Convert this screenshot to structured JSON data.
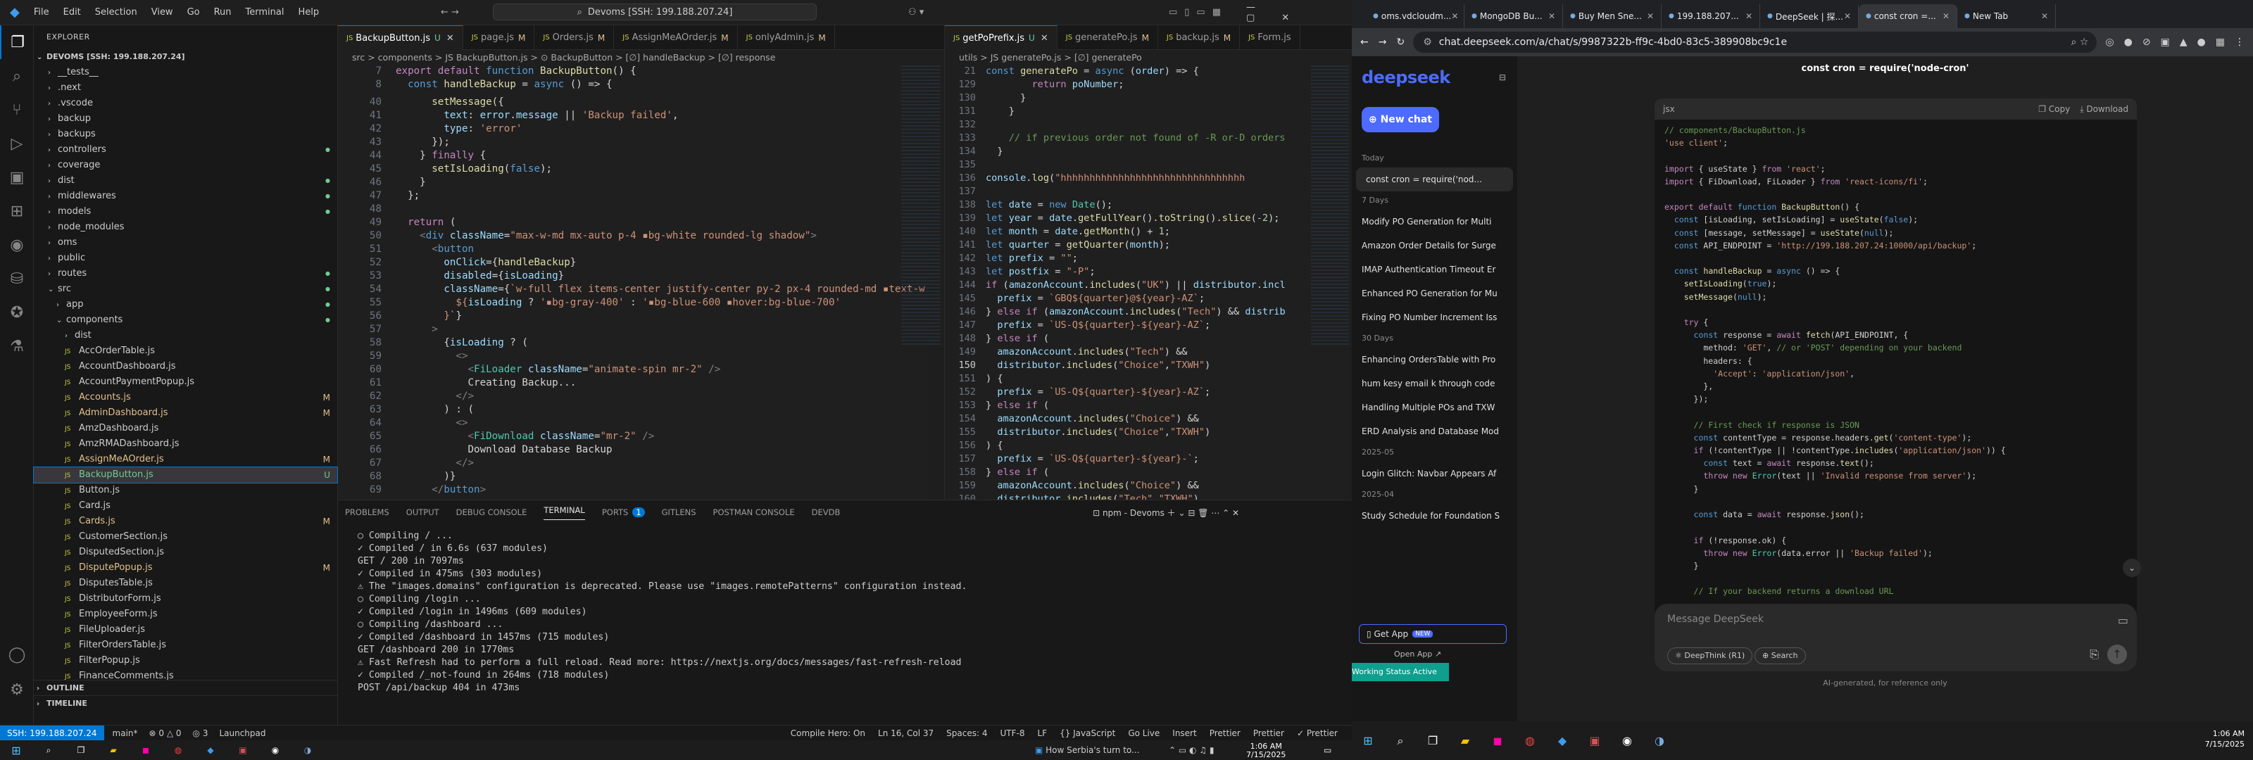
{
  "vscode": {
    "menu": [
      "File",
      "Edit",
      "Selection",
      "View",
      "Go",
      "Run",
      "Terminal",
      "Help"
    ],
    "command_center": "Devoms [SSH: 199.188.207.24]",
    "explorer_title": "EXPLORER",
    "root": "DEVOMS [SSH: 199.188.207.24]",
    "tree": [
      {
        "l": "__tests__",
        "d": 1,
        "c": true
      },
      {
        "l": ".next",
        "d": 1,
        "c": true
      },
      {
        "l": ".vscode",
        "d": 1,
        "c": true
      },
      {
        "l": "backup",
        "d": 1,
        "c": true
      },
      {
        "l": "backups",
        "d": 1,
        "c": true
      },
      {
        "l": "controllers",
        "d": 1,
        "c": true,
        "dot": true
      },
      {
        "l": "coverage",
        "d": 1,
        "c": true
      },
      {
        "l": "dist",
        "d": 1,
        "c": true,
        "dot": true
      },
      {
        "l": "middlewares",
        "d": 1,
        "c": true,
        "dot": true
      },
      {
        "l": "models",
        "d": 1,
        "c": true,
        "dot": true
      },
      {
        "l": "node_modules",
        "d": 1,
        "c": true
      },
      {
        "l": "oms",
        "d": 1,
        "c": true
      },
      {
        "l": "public",
        "d": 1,
        "c": true
      },
      {
        "l": "routes",
        "d": 1,
        "c": true,
        "dot": true
      },
      {
        "l": "src",
        "d": 1,
        "o": true,
        "dot": true
      },
      {
        "l": "app",
        "d": 2,
        "c": true,
        "dot": true
      },
      {
        "l": "components",
        "d": 2,
        "o": true,
        "dot": true
      },
      {
        "l": "dist",
        "d": 3,
        "c": true
      },
      {
        "l": "AccOrderTable.js",
        "d": 3
      },
      {
        "l": "AccountDashboard.js",
        "d": 3
      },
      {
        "l": "AccountPaymentPopup.js",
        "d": 3
      },
      {
        "l": "Accounts.js",
        "d": 3,
        "b": "M"
      },
      {
        "l": "AdminDashboard.js",
        "d": 3,
        "b": "M"
      },
      {
        "l": "AmzDashboard.js",
        "d": 3
      },
      {
        "l": "AmzRMADashboard.js",
        "d": 3
      },
      {
        "l": "AssignMeAOrder.js",
        "d": 3,
        "b": "M"
      },
      {
        "l": "BackupButton.js",
        "d": 3,
        "b": "U",
        "sel": true
      },
      {
        "l": "Button.js",
        "d": 3
      },
      {
        "l": "Card.js",
        "d": 3
      },
      {
        "l": "Cards.js",
        "d": 3,
        "b": "M"
      },
      {
        "l": "CustomerSection.js",
        "d": 3
      },
      {
        "l": "DisputedSection.js",
        "d": 3
      },
      {
        "l": "DisputePopup.js",
        "d": 3,
        "b": "M"
      },
      {
        "l": "DisputesTable.js",
        "d": 3
      },
      {
        "l": "DistributorForm.js",
        "d": 3
      },
      {
        "l": "EmployeeForm.js",
        "d": 3
      },
      {
        "l": "FileUploader.js",
        "d": 3
      },
      {
        "l": "FilterOrdersTable.js",
        "d": 3
      },
      {
        "l": "FilterPopup.js",
        "d": 3
      },
      {
        "l": "FinanceComments.js",
        "d": 3
      }
    ],
    "outline": "OUTLINE",
    "timeline": "TIMELINE",
    "tabs1": [
      {
        "l": "BackupButton.js",
        "b": "U",
        "a": true
      },
      {
        "l": "page.js",
        "b": "M"
      },
      {
        "l": "Orders.js",
        "b": "M"
      },
      {
        "l": "AssignMeAOrder.js",
        "b": "M"
      },
      {
        "l": "onlyAdmin.js",
        "b": "M"
      }
    ],
    "tabs2": [
      {
        "l": "getPoPrefix.js",
        "b": "U",
        "a": true
      },
      {
        "l": "generatePo.js",
        "b": "M"
      },
      {
        "l": "backup.js",
        "b": "M"
      },
      {
        "l": "Form.js"
      }
    ],
    "crumb1": "src > components > JS BackupButton.js > ⊙ BackupButton > [∅] handleBackup > [∅] response",
    "crumb2": "utils > JS generatePo.js > [∅] generatePo",
    "panel_tabs": [
      "PROBLEMS",
      "OUTPUT",
      "DEBUG CONSOLE",
      "TERMINAL",
      "PORTS",
      "GITLENS",
      "POSTMAN CONSOLE",
      "DEVDB"
    ],
    "ports_badge": "1",
    "term_label": "npm - Devoms",
    "terminal": [
      "○ Compiling / ...",
      "✓ Compiled / in 6.6s (637 modules)",
      "GET / 200 in 7097ms",
      "✓ Compiled in 475ms (303 modules)",
      "⚠ The \"images.domains\" configuration is deprecated. Please use \"images.remotePatterns\" configuration instead.",
      "○ Compiling /login ...",
      "✓ Compiled /login in 1496ms (609 modules)",
      "○ Compiling /dashboard ...",
      "✓ Compiled /dashboard in 1457ms (715 modules)",
      "GET /dashboard 200 in 1770ms",
      "⚠ Fast Refresh had to perform a full reload. Read more: https://nextjs.org/docs/messages/fast-refresh-reload",
      "✓ Compiled /_not-found in 264ms (718 modules)",
      "POST /api/backup 404 in 473ms"
    ],
    "status_left": [
      "SSH: 199.188.207.24",
      "main*",
      "⊗ 0 △ 0",
      "◎ 3",
      "Launchpad"
    ],
    "status_right": [
      "Compile Hero: On",
      "Ln 16, Col 37",
      "Spaces: 4",
      "UTF-8",
      "LF",
      "{} JavaScript",
      "Go Live",
      "Insert",
      "Prettier",
      "Prettier",
      "✓ Prettier"
    ],
    "news": "How Serbia's turn to...",
    "clock_time": "1:06 AM",
    "clock_date": "7/15/2025"
  },
  "chrome": {
    "tabs": [
      "oms.vdcloudm...",
      "MongoDB Bu...",
      "Buy Men Sne...",
      "199.188.207...",
      "DeepSeek | 探...",
      "const cron =...",
      "New Tab"
    ],
    "url": "chat.deepseek.com/a/chat/s/9987322b-ff9c-4bd0-83c5-389908bc9c1e",
    "logo": "deepseek",
    "new_chat": "New chat",
    "sections": [
      {
        "h": "Today",
        "items": [
          "const cron = require('nod..."
        ]
      },
      {
        "h": "7 Days",
        "items": [
          "Modify PO Generation for Multi",
          "Amazon Order Details for Surge",
          "IMAP Authentication Timeout Er",
          "Enhanced PO Generation for Mu",
          "Fixing PO Number Increment Iss"
        ]
      },
      {
        "h": "30 Days",
        "items": [
          "Enhancing OrdersTable with Pro",
          "hum kesy email k through code",
          "Handling Multiple POs and TXW",
          "ERD Analysis and Database Mod"
        ]
      },
      {
        "h": "2025-05",
        "items": [
          "Login Glitch: Navbar Appears Af"
        ]
      },
      {
        "h": "2025-04",
        "items": [
          "Study Schedule for Foundation S"
        ]
      }
    ],
    "get_app": "Get App",
    "new_badge": "NEW",
    "open_app": "Open App ↗",
    "chat_title": "const cron = require('node-cron'",
    "lang": "jsx",
    "copy": "Copy",
    "download": "Download",
    "placeholder": "Message DeepSeek",
    "deepthink": "DeepThink (R1)",
    "search": "Search",
    "footer": "AI-generated, for reference only",
    "wstatus": "Working Status Active",
    "time": "1:06 AM",
    "date": "7/15/2025"
  }
}
